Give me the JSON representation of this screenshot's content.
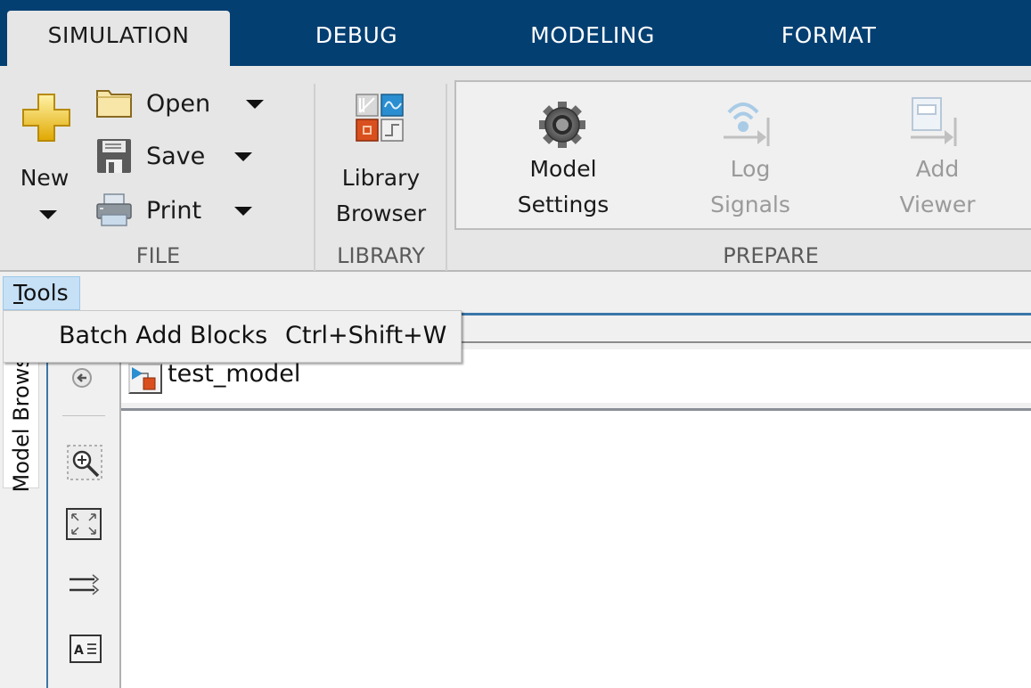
{
  "tabs": [
    {
      "label": "SIMULATION",
      "active": true
    },
    {
      "label": "DEBUG",
      "active": false
    },
    {
      "label": "MODELING",
      "active": false
    },
    {
      "label": "FORMAT",
      "active": false
    }
  ],
  "ribbon": {
    "file": {
      "section_label": "FILE",
      "new_label": "New",
      "open_label": "Open",
      "save_label": "Save",
      "print_label": "Print"
    },
    "library": {
      "section_label": "LIBRARY",
      "library_browser_line1": "Library",
      "library_browser_line2": "Browser"
    },
    "prepare": {
      "section_label": "PREPARE",
      "model_settings_line1": "Model",
      "model_settings_line2": "Settings",
      "log_signals_line1": "Log",
      "log_signals_line2": "Signals",
      "add_viewer_line1": "Add",
      "add_viewer_line2": "Viewer"
    }
  },
  "menubar": {
    "tools_mnemonic": "T",
    "tools_rest": "ools"
  },
  "tools_menu": {
    "items": [
      {
        "label": "Batch Add Blocks",
        "shortcut": "Ctrl+Shift+W"
      }
    ]
  },
  "side_panel": {
    "tab_label": "Model Browser"
  },
  "editor": {
    "breadcrumb_model": "test_model"
  },
  "colors": {
    "tabstrip": "#043f72",
    "accent_blue": "#3a76a8",
    "menu_highlight": "#c6e0f5"
  }
}
